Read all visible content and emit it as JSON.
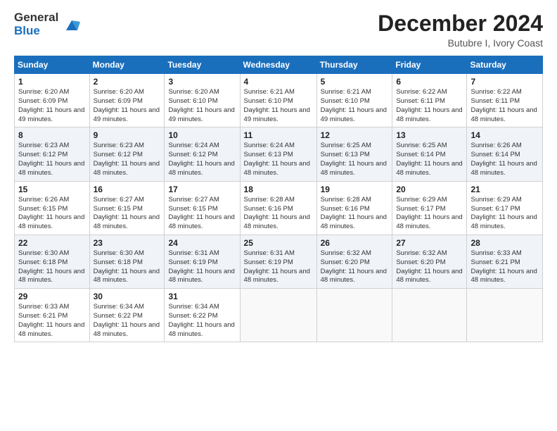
{
  "logo": {
    "general": "General",
    "blue": "Blue"
  },
  "header": {
    "month": "December 2024",
    "location": "Butubre I, Ivory Coast"
  },
  "weekdays": [
    "Sunday",
    "Monday",
    "Tuesday",
    "Wednesday",
    "Thursday",
    "Friday",
    "Saturday"
  ],
  "weeks": [
    [
      {
        "day": "1",
        "sunrise": "6:20 AM",
        "sunset": "6:09 PM",
        "daylight": "11 hours and 49 minutes."
      },
      {
        "day": "2",
        "sunrise": "6:20 AM",
        "sunset": "6:09 PM",
        "daylight": "11 hours and 49 minutes."
      },
      {
        "day": "3",
        "sunrise": "6:20 AM",
        "sunset": "6:10 PM",
        "daylight": "11 hours and 49 minutes."
      },
      {
        "day": "4",
        "sunrise": "6:21 AM",
        "sunset": "6:10 PM",
        "daylight": "11 hours and 49 minutes."
      },
      {
        "day": "5",
        "sunrise": "6:21 AM",
        "sunset": "6:10 PM",
        "daylight": "11 hours and 49 minutes."
      },
      {
        "day": "6",
        "sunrise": "6:22 AM",
        "sunset": "6:11 PM",
        "daylight": "11 hours and 48 minutes."
      },
      {
        "day": "7",
        "sunrise": "6:22 AM",
        "sunset": "6:11 PM",
        "daylight": "11 hours and 48 minutes."
      }
    ],
    [
      {
        "day": "8",
        "sunrise": "6:23 AM",
        "sunset": "6:12 PM",
        "daylight": "11 hours and 48 minutes."
      },
      {
        "day": "9",
        "sunrise": "6:23 AM",
        "sunset": "6:12 PM",
        "daylight": "11 hours and 48 minutes."
      },
      {
        "day": "10",
        "sunrise": "6:24 AM",
        "sunset": "6:12 PM",
        "daylight": "11 hours and 48 minutes."
      },
      {
        "day": "11",
        "sunrise": "6:24 AM",
        "sunset": "6:13 PM",
        "daylight": "11 hours and 48 minutes."
      },
      {
        "day": "12",
        "sunrise": "6:25 AM",
        "sunset": "6:13 PM",
        "daylight": "11 hours and 48 minutes."
      },
      {
        "day": "13",
        "sunrise": "6:25 AM",
        "sunset": "6:14 PM",
        "daylight": "11 hours and 48 minutes."
      },
      {
        "day": "14",
        "sunrise": "6:26 AM",
        "sunset": "6:14 PM",
        "daylight": "11 hours and 48 minutes."
      }
    ],
    [
      {
        "day": "15",
        "sunrise": "6:26 AM",
        "sunset": "6:15 PM",
        "daylight": "11 hours and 48 minutes."
      },
      {
        "day": "16",
        "sunrise": "6:27 AM",
        "sunset": "6:15 PM",
        "daylight": "11 hours and 48 minutes."
      },
      {
        "day": "17",
        "sunrise": "6:27 AM",
        "sunset": "6:15 PM",
        "daylight": "11 hours and 48 minutes."
      },
      {
        "day": "18",
        "sunrise": "6:28 AM",
        "sunset": "6:16 PM",
        "daylight": "11 hours and 48 minutes."
      },
      {
        "day": "19",
        "sunrise": "6:28 AM",
        "sunset": "6:16 PM",
        "daylight": "11 hours and 48 minutes."
      },
      {
        "day": "20",
        "sunrise": "6:29 AM",
        "sunset": "6:17 PM",
        "daylight": "11 hours and 48 minutes."
      },
      {
        "day": "21",
        "sunrise": "6:29 AM",
        "sunset": "6:17 PM",
        "daylight": "11 hours and 48 minutes."
      }
    ],
    [
      {
        "day": "22",
        "sunrise": "6:30 AM",
        "sunset": "6:18 PM",
        "daylight": "11 hours and 48 minutes."
      },
      {
        "day": "23",
        "sunrise": "6:30 AM",
        "sunset": "6:18 PM",
        "daylight": "11 hours and 48 minutes."
      },
      {
        "day": "24",
        "sunrise": "6:31 AM",
        "sunset": "6:19 PM",
        "daylight": "11 hours and 48 minutes."
      },
      {
        "day": "25",
        "sunrise": "6:31 AM",
        "sunset": "6:19 PM",
        "daylight": "11 hours and 48 minutes."
      },
      {
        "day": "26",
        "sunrise": "6:32 AM",
        "sunset": "6:20 PM",
        "daylight": "11 hours and 48 minutes."
      },
      {
        "day": "27",
        "sunrise": "6:32 AM",
        "sunset": "6:20 PM",
        "daylight": "11 hours and 48 minutes."
      },
      {
        "day": "28",
        "sunrise": "6:33 AM",
        "sunset": "6:21 PM",
        "daylight": "11 hours and 48 minutes."
      }
    ],
    [
      {
        "day": "29",
        "sunrise": "6:33 AM",
        "sunset": "6:21 PM",
        "daylight": "11 hours and 48 minutes."
      },
      {
        "day": "30",
        "sunrise": "6:34 AM",
        "sunset": "6:22 PM",
        "daylight": "11 hours and 48 minutes."
      },
      {
        "day": "31",
        "sunrise": "6:34 AM",
        "sunset": "6:22 PM",
        "daylight": "11 hours and 48 minutes."
      },
      null,
      null,
      null,
      null
    ]
  ]
}
